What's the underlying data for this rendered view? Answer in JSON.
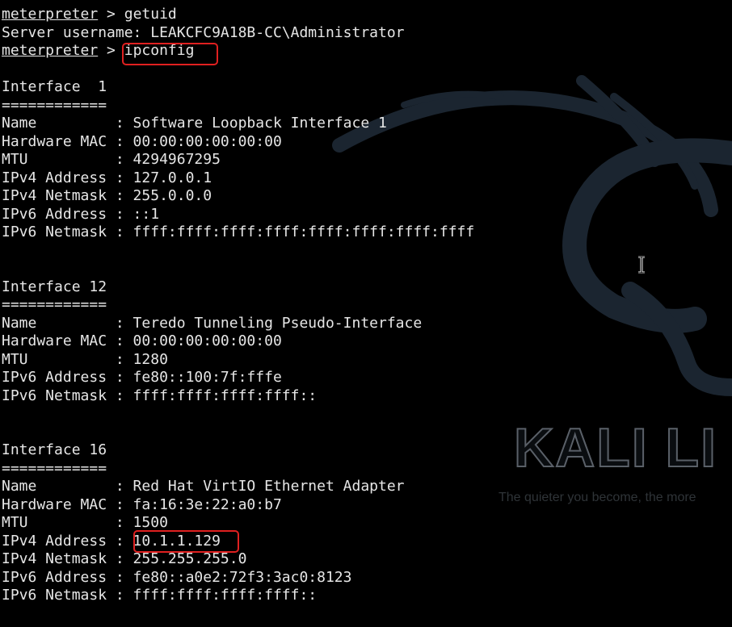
{
  "terminal": {
    "lines": [
      {
        "prompt": "meterpreter",
        "sep": " > ",
        "cmd": "getuid"
      },
      {
        "text": "Server username: LEAKCFC9A18B-CC\\Administrator"
      },
      {
        "prompt": "meterpreter",
        "sep": " > ",
        "cmd": "ipconfig"
      },
      {
        "text": ""
      },
      {
        "text": "Interface  1"
      },
      {
        "text": "============"
      },
      {
        "text": "Name         : Software Loopback Interface 1"
      },
      {
        "text": "Hardware MAC : 00:00:00:00:00:00"
      },
      {
        "text": "MTU          : 4294967295"
      },
      {
        "text": "IPv4 Address : 127.0.0.1"
      },
      {
        "text": "IPv4 Netmask : 255.0.0.0"
      },
      {
        "text": "IPv6 Address : ::1"
      },
      {
        "text": "IPv6 Netmask : ffff:ffff:ffff:ffff:ffff:ffff:ffff:ffff"
      },
      {
        "text": ""
      },
      {
        "text": ""
      },
      {
        "text": "Interface 12"
      },
      {
        "text": "============"
      },
      {
        "text": "Name         : Teredo Tunneling Pseudo-Interface"
      },
      {
        "text": "Hardware MAC : 00:00:00:00:00:00"
      },
      {
        "text": "MTU          : 1280"
      },
      {
        "text": "IPv6 Address : fe80::100:7f:fffe"
      },
      {
        "text": "IPv6 Netmask : ffff:ffff:ffff:ffff::"
      },
      {
        "text": ""
      },
      {
        "text": ""
      },
      {
        "text": "Interface 16"
      },
      {
        "text": "============"
      },
      {
        "text": "Name         : Red Hat VirtIO Ethernet Adapter"
      },
      {
        "text": "Hardware MAC : fa:16:3e:22:a0:b7"
      },
      {
        "text": "MTU          : 1500"
      },
      {
        "text": "IPv4 Address : 10.1.1.129"
      },
      {
        "text": "IPv4 Netmask : 255.255.255.0"
      },
      {
        "text": "IPv6 Address : fe80::a0e2:72f3:3ac0:8123"
      },
      {
        "text": "IPv6 Netmask : ffff:ffff:ffff:ffff::"
      }
    ]
  },
  "wallpaper": {
    "logo_text": "KALI LI",
    "tagline": "The quieter you become, the more"
  },
  "highlights": [
    {
      "label": "ipconfig command",
      "color": "#e02020"
    },
    {
      "label": "IPv4 address 10.1.1.129",
      "color": "#e02020"
    }
  ],
  "colors": {
    "background": "#000000",
    "text": "#e6e6e6",
    "highlight": "#e02020"
  },
  "icons": [
    "dragon-logo-icon",
    "text-cursor-icon"
  ]
}
